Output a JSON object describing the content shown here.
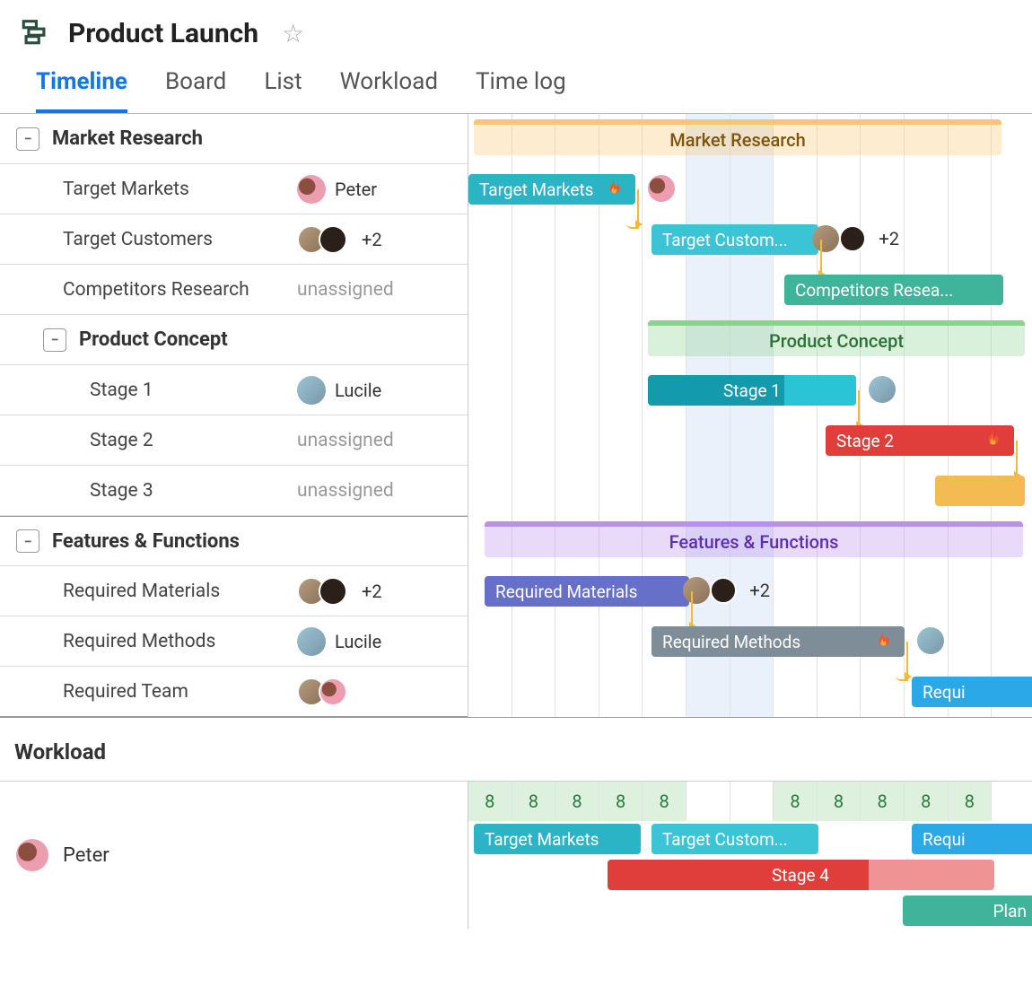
{
  "header": {
    "title": "Product Launch"
  },
  "tabs": [
    "Timeline",
    "Board",
    "List",
    "Workload",
    "Time log"
  ],
  "active_tab": 0,
  "groups": [
    {
      "id": "mr",
      "name": "Market Research",
      "center": true,
      "start": 6,
      "span": 588,
      "color": "#f8c671",
      "textcolor": "#7a5610",
      "tasks": [
        {
          "name": "Target Markets",
          "assignee": "Peter",
          "avatars": [
            "peter"
          ],
          "bar": {
            "start": 0,
            "span": 186,
            "color": "#2bb3c6",
            "label": "Target Markets",
            "flame": true,
            "trail_av": [
              "peter"
            ]
          }
        },
        {
          "name": "Target Customers",
          "avatars": [
            "m1",
            "m2"
          ],
          "extra": "+2",
          "bar": {
            "start": 204,
            "span": 186,
            "color": "#3bc4d6",
            "label": "Target Custom...",
            "trail_av": [
              "m1",
              "m2"
            ],
            "trail_extra": "+2"
          }
        },
        {
          "name": "Competitors Research",
          "unassigned": true,
          "bar": {
            "start": 352,
            "span": 244,
            "color": "#3fb49a",
            "label": "Competitors Resea..."
          }
        }
      ],
      "subgroup": {
        "name": "Product Concept",
        "start": 200,
        "span": 420,
        "color": "#8dd18f",
        "textcolor": "#2a7038",
        "tasks": [
          {
            "name": "Stage 1",
            "assignee": "Lucile",
            "avatars": [
              "lucile"
            ],
            "bar": {
              "start": 200,
              "span": 232,
              "color": "#139aad",
              "overlay": {
                "start": 352,
                "span": 80,
                "color": "#2bc4d6"
              },
              "label": "Stage 1",
              "center": true,
              "trail_av": [
                "lucile"
              ]
            }
          },
          {
            "name": "Stage 2",
            "unassigned": true,
            "bar": {
              "start": 398,
              "span": 210,
              "color": "#df3e3a",
              "label": "Stage 2",
              "center": true,
              "flame": true
            }
          },
          {
            "name": "Stage 3",
            "unassigned": true,
            "bar": {
              "start": 520,
              "span": 100,
              "color": "#f4bb52",
              "label": ""
            }
          }
        ]
      }
    },
    {
      "id": "ff",
      "name": "Features & Functions",
      "center": true,
      "start": 18,
      "span": 600,
      "color": "#b991eb",
      "textcolor": "#5a2fb0",
      "tasks": [
        {
          "name": "Required Materials",
          "avatars": [
            "m1",
            "m2"
          ],
          "extra": "+2",
          "bar": {
            "start": 18,
            "span": 228,
            "color": "#6670c8",
            "label": "Required Materials",
            "trail_av": [
              "m1",
              "m2"
            ],
            "trail_extra": "+2"
          }
        },
        {
          "name": "Required Methods",
          "assignee": "Lucile",
          "avatars": [
            "lucile"
          ],
          "bar": {
            "start": 204,
            "span": 282,
            "color": "#7e8d98",
            "label": "Required Methods",
            "flame": true,
            "trail_av": [
              "lucile"
            ]
          }
        },
        {
          "name": "Required Team",
          "avatars": [
            "m1",
            "peter2"
          ],
          "bar": {
            "start": 494,
            "span": 140,
            "color": "#2ba8e6",
            "label": "Requi"
          }
        }
      ]
    }
  ],
  "workload": {
    "title": "Workload",
    "person": {
      "name": "Peter",
      "avatar": "peter"
    },
    "cells": [
      "8",
      "8",
      "8",
      "8",
      "8",
      "",
      "",
      "8",
      "8",
      "8",
      "8",
      "8"
    ],
    "bars": [
      {
        "start": 6,
        "span": 186,
        "color": "#2bb3c6",
        "label": "Target Markets"
      },
      {
        "start": 204,
        "span": 186,
        "color": "#3bc4d6",
        "label": "Target Custom..."
      },
      {
        "start": 494,
        "span": 138,
        "color": "#2ba8e6",
        "label": "Requi"
      },
      {
        "start": 155,
        "span": 430,
        "color": "#df3e3a",
        "overlay": {
          "start": 446,
          "span": 140,
          "color": "#ef9394"
        },
        "label": "Stage 4",
        "row": 1,
        "center": true
      },
      {
        "start": 484,
        "span": 150,
        "color": "#3fb49a",
        "label": "Plan",
        "row": 2,
        "right": true
      }
    ]
  },
  "colors": {
    "accent": "#1176e6"
  },
  "grid": {
    "highlight_start": 5,
    "cell_w": 48.6,
    "cols": 13
  }
}
